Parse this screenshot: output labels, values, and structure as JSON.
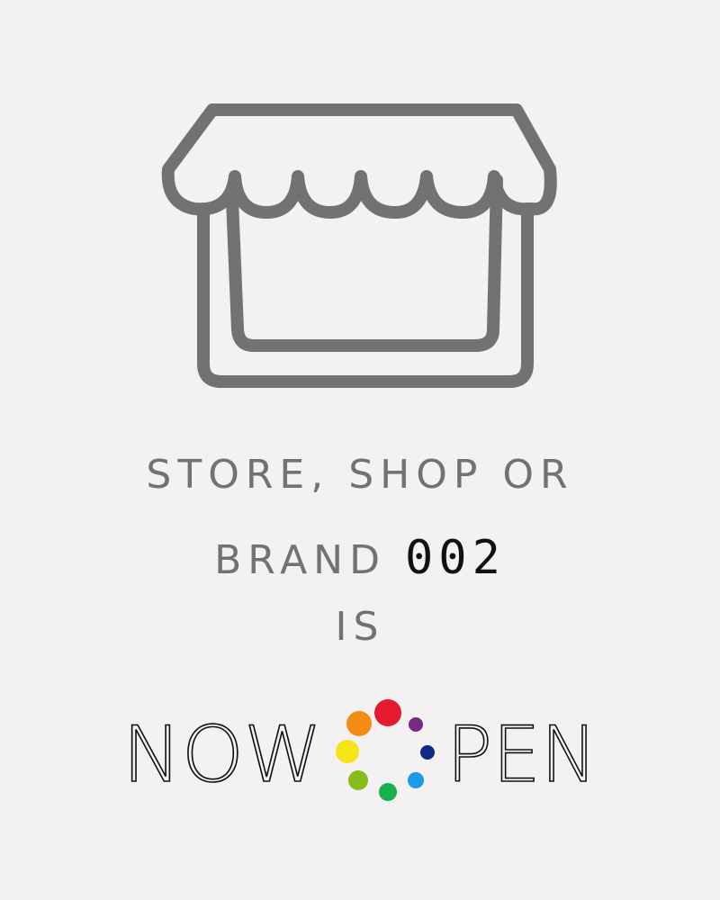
{
  "headline": {
    "line1": "STORE, SHOP OR",
    "line2_prefix": "BRAND",
    "brand_number": "002",
    "line3": "IS"
  },
  "now_open": {
    "word1": "NOW",
    "word2": "PEN",
    "colors": {
      "text": "#111111",
      "dots": [
        "#e6192e",
        "#7a2a86",
        "#102a8a",
        "#1a9be6",
        "#18b04a",
        "#86bd1a",
        "#f5e514",
        "#f28c14"
      ]
    }
  },
  "icons": {
    "store": "storefront-icon",
    "rainbow_o": "rainbow-dot-circle-icon"
  },
  "colors": {
    "background": "#f3f1f2",
    "gray_text": "#727272",
    "icon_stroke": "#727272",
    "accent_text": "#111111"
  }
}
